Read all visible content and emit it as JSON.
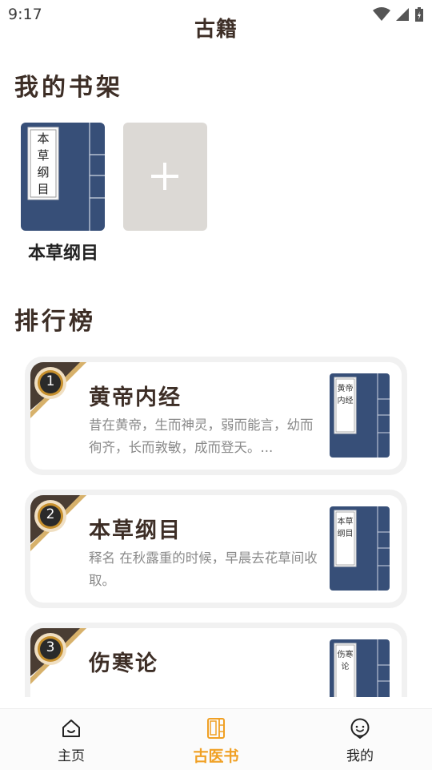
{
  "status_bar": {
    "time": "9:17"
  },
  "header": {
    "title": "古籍"
  },
  "bookshelf": {
    "title": "我的书架",
    "books": [
      {
        "title": "本草纲目",
        "cover_text": "本草纲目"
      }
    ],
    "add_icon": "plus-icon"
  },
  "ranking": {
    "title": "排行榜",
    "items": [
      {
        "rank": "1",
        "title": "黄帝内经",
        "desc": "昔在黄帝，生而神灵，弱而能言，幼而徇齐，长而敦敏，成而登天。...",
        "cover_text": "黄帝内经"
      },
      {
        "rank": "2",
        "title": "本草纲目",
        "desc": "释名 在秋露重的时候，早晨去花草间收取。",
        "cover_text": "本草纲目"
      },
      {
        "rank": "3",
        "title": "伤寒论",
        "desc": "",
        "cover_text": "伤寒论"
      }
    ]
  },
  "bottom_nav": {
    "items": [
      {
        "label": "主页",
        "icon": "home-icon",
        "active": false
      },
      {
        "label": "古医书",
        "icon": "book-icon",
        "active": true
      },
      {
        "label": "我的",
        "icon": "face-icon",
        "active": false
      }
    ]
  },
  "colors": {
    "accent": "#f0a024",
    "cover_blue": "#374f78",
    "add_tile": "#dcd9d5",
    "ribbon": "#4a3d33"
  }
}
